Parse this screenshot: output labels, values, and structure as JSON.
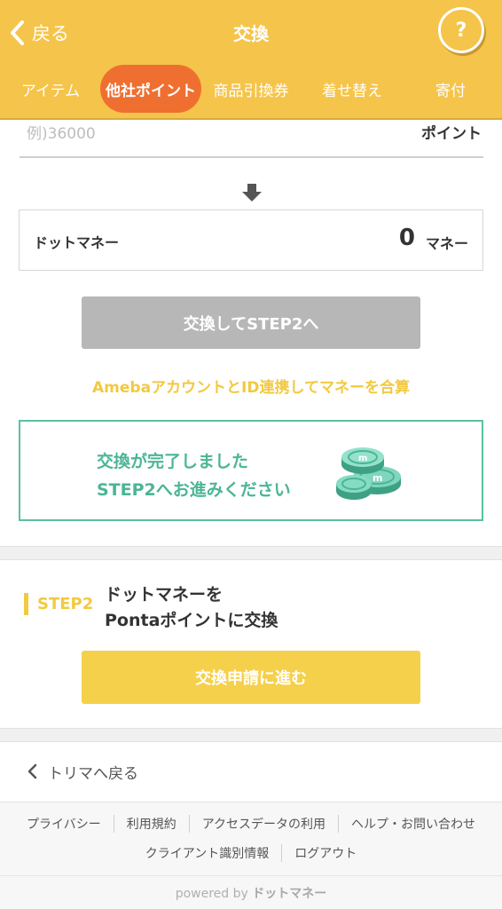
{
  "header": {
    "back_label": "戻る",
    "title": "交換",
    "help_label": "?",
    "tabs": [
      {
        "label": "アイテム"
      },
      {
        "label": "他社ポイント"
      },
      {
        "label": "商品引換券"
      },
      {
        "label": "着せ替え"
      },
      {
        "label": "寄付"
      }
    ],
    "active_tab": "他社ポイント"
  },
  "form": {
    "points_placeholder": "例)36000",
    "points_unit": "ポイント",
    "money_label": "ドットマネー",
    "money_value": "0",
    "money_unit": "マネー",
    "exchange_button": "交換してSTEP2へ",
    "ameba_link": "Amebaアカウントと ID連携してマネーを合算"
  },
  "complete": {
    "line1": "交換が完了しました",
    "line2": "STEP2へお進みください",
    "icon": "coins-icon"
  },
  "step2": {
    "label": "STEP2",
    "text_line1": "ドットマネーを",
    "text_line2": "Pontaポイントに交換",
    "button": "交換申請に進む"
  },
  "nav": {
    "back_to_trima": "トリマへ戻る"
  },
  "footer": {
    "links_row1": [
      "プライバシー",
      "利用規約",
      "アクセスデータの利用",
      "ヘルプ・お問い合わせ"
    ],
    "links_row2": [
      "クライアント識別情報",
      "ログアウト"
    ],
    "powered_prefix": "powered by",
    "powered_brand": "ドットマネー"
  },
  "colors": {
    "header_bg": "#f5c44a",
    "active_tab": "#ef6f31",
    "accent_yellow": "#f2c940",
    "accent_green": "#4bb596"
  }
}
